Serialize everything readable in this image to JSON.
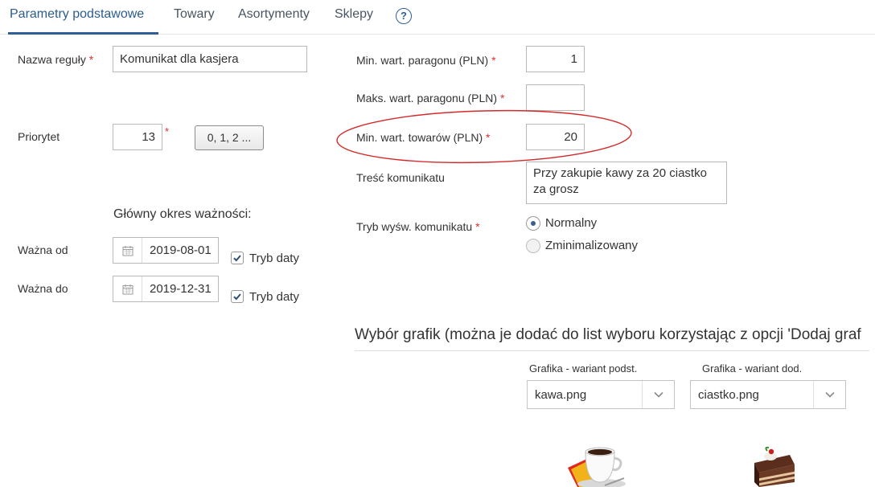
{
  "tabs": [
    {
      "label": "Parametry podstawowe",
      "active": true
    },
    {
      "label": "Towary"
    },
    {
      "label": "Asortymenty"
    },
    {
      "label": "Sklepy"
    }
  ],
  "help_icon": "question-circle-icon",
  "left": {
    "rule_name_label": "Nazwa reguły",
    "rule_name_value": "Komunikat dla kasjera",
    "priority_label": "Priorytet",
    "priority_value": "13",
    "priority_button": "0, 1, 2 ...",
    "validity_heading": "Główny okres ważności:",
    "valid_from_label": "Ważna od",
    "valid_from_value": "2019-08-01",
    "valid_to_label": "Ważna do",
    "valid_to_value": "2019-12-31",
    "date_mode_label": "Tryb daty",
    "required_mark": "*"
  },
  "right": {
    "min_receipt_label": "Min. wart. paragonu (PLN)",
    "min_receipt_value": "1",
    "max_receipt_label": "Maks. wart. paragonu (PLN)",
    "max_receipt_value": "",
    "min_goods_label": "Min. wart. towarów (PLN)",
    "min_goods_value": "20",
    "message_label": "Treść komunikatu",
    "message_line1": "Przy zakupie  kawy za 20  ciastko",
    "message_line2": "za grosz",
    "display_mode_label": "Tryb wyśw. komunikatu",
    "mode_normal": "Normalny",
    "mode_minimized": "Zminimalizowany",
    "selected_mode": "Normalny"
  },
  "graphics": {
    "title": "Wybór grafik (można je dodać do list wyboru korzystając z opcji 'Dodaj graf",
    "basic_label": "Grafika - wariant podst.",
    "basic_value": "kawa.png",
    "extra_label": "Grafika - wariant dod.",
    "extra_value": "ciastko.png"
  },
  "colors": {
    "accent": "#2f5f94",
    "required": "#e03030",
    "highlight_ellipse": "#d42a2a"
  }
}
